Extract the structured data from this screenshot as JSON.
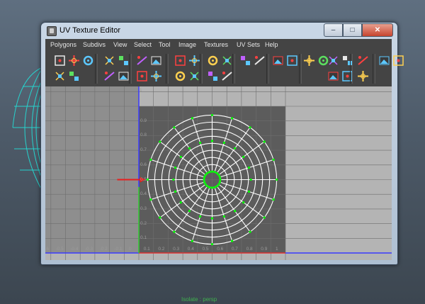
{
  "window": {
    "title": "UV Texture Editor",
    "buttons": {
      "minimize": "–",
      "maximize": "□",
      "close": "✕"
    }
  },
  "menu": [
    "Polygons",
    "Subdivs",
    "View",
    "Select",
    "Tool",
    "Image",
    "Textures",
    "UV Sets",
    "Help"
  ],
  "toolbar": {
    "row1_icons": [
      "select-uvs-icon",
      "select-uv-shell-icon",
      "uv-lattice-icon",
      "flip-u-icon",
      "flip-v-icon",
      "rotate-ccw-icon",
      "rotate-cw-icon",
      "cut-uv-edges-icon",
      "sew-uv-edges-icon",
      "move-sew-icon",
      "merge-uvs-icon",
      "map-uv-border-icon",
      "straighten-uvs-icon",
      "grid-uvs-icon",
      "unfold-uvs-icon",
      "layout-uvs-icon",
      "display-image-icon",
      "checker-icon",
      "pixel-snap-icon",
      "texture-borders-icon",
      "copy-uvs-icon",
      "paste-uvs-icon"
    ],
    "row2_icons": [
      "uv-smudge-icon",
      "uv-relax-icon",
      "isolate-select-icon",
      "add-isolate-icon",
      "remove-isolate-icon",
      "snapshot-icon",
      "uv-distortion-icon",
      "uv-shading-icon",
      "tiles-icon",
      "dim-image-icon",
      "rgb-channels-icon",
      "alpha-channel-icon",
      "image-ratio-icon"
    ]
  },
  "uv_editor": {
    "axis_top_label": "1",
    "v_tick_labels": [
      "0.9",
      "0.8",
      "0.7",
      "0.6",
      "0.5",
      "0.4",
      "0.3",
      "0.2",
      "0.1",
      "-0.1"
    ],
    "u_tick_labels": [
      "-0.6",
      "-0.5",
      "-0.4",
      "-0.3",
      "-0.2",
      "-0.1",
      "0",
      "0.1",
      "0.2",
      "0.3",
      "0.4",
      "0.5",
      "0.6",
      "0.7",
      "0.8",
      "0.9",
      "1"
    ],
    "uv_shell": {
      "rings": 8,
      "spokes": 20,
      "edge_color": "#ffffff",
      "vertex_color": "#00ff00"
    },
    "colors": {
      "background": "#b4b4b4",
      "uv_tile": "#5c5c5c",
      "u_axis": "#3a3aff",
      "v_axis_positive": "#2ecc2e",
      "u_axis_positive": "#e03030",
      "grid": "#6e6e6e"
    }
  },
  "annotation": {
    "arrow_color": "#e81e1e"
  },
  "viewport": {
    "bottom_label": "Isolate : persp"
  }
}
